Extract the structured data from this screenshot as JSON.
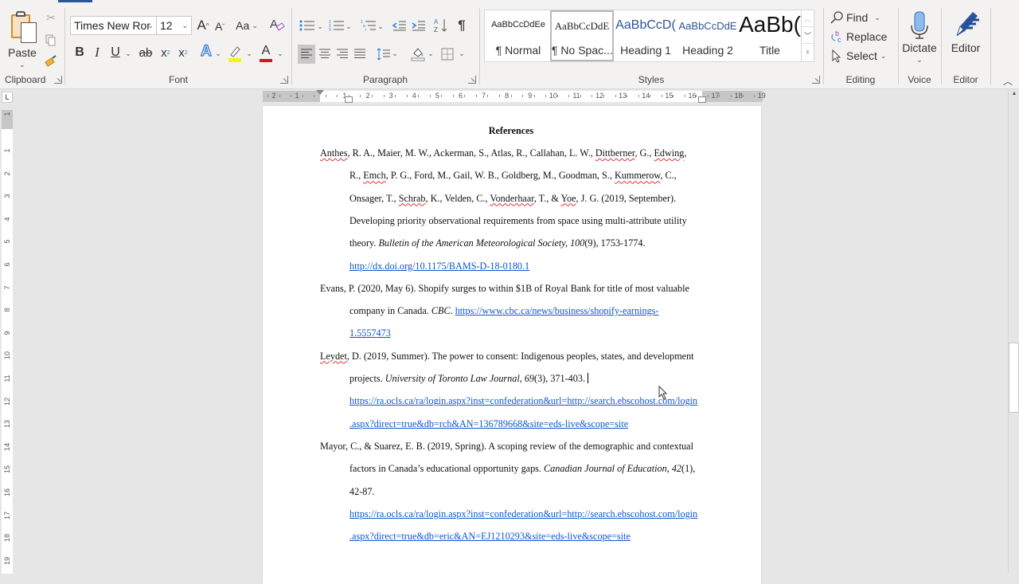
{
  "ribbon": {
    "clipboard": {
      "label": "Clipboard",
      "paste": "Paste"
    },
    "font": {
      "label": "Font",
      "font_name": "Times New Ror",
      "font_size": "12",
      "grow": "A",
      "shrink": "A",
      "change_case": "Aa",
      "bold": "B",
      "italic": "I",
      "underline": "U",
      "strikethrough": "ab",
      "subscript": "x",
      "superscript": "x",
      "text_effects": "A",
      "font_color": "A",
      "highlight_color": "#f5f11b",
      "font_color_value": "#d9161c"
    },
    "paragraph": {
      "label": "Paragraph",
      "show_marks": "¶"
    },
    "styles": {
      "label": "Styles",
      "items": [
        {
          "preview": "AaBbCcDdEe",
          "name": "¶ Normal"
        },
        {
          "preview": "AaBbCcDdE",
          "name": "¶ No Spac..."
        },
        {
          "preview": "AaBbCcD(",
          "name": "Heading 1"
        },
        {
          "preview": "AaBbCcDdE",
          "name": "Heading 2"
        },
        {
          "preview": "AaBb(",
          "name": "Title"
        }
      ]
    },
    "editing": {
      "label": "Editing",
      "find": "Find",
      "replace": "Replace",
      "select": "Select"
    },
    "voice": {
      "label": "Voice",
      "dictate": "Dictate"
    },
    "editor": {
      "label": "Editor",
      "editor_btn": "Editor"
    }
  },
  "rulers": {
    "horizontal": [
      "2",
      "1",
      "1",
      "2",
      "3",
      "4",
      "5",
      "6",
      "7",
      "8",
      "9",
      "10",
      "11",
      "12",
      "13",
      "14",
      "15",
      "16",
      "17",
      "18",
      "19"
    ],
    "vertical": [
      "1",
      "1",
      "2",
      "3",
      "4",
      "5",
      "6",
      "7",
      "8",
      "9",
      "10",
      "11",
      "12",
      "13",
      "14",
      "15",
      "16",
      "17",
      "18",
      "19"
    ]
  },
  "document": {
    "title": "References",
    "references": [
      {
        "lines": [
          [
            {
              "t": "Anthes",
              "sq": true
            },
            {
              "t": ", R. A., Maier, M. W., Ackerman, S., Atlas, R., Callahan, L. W., "
            },
            {
              "t": "Dittberner",
              "sq": true
            },
            {
              "t": ", G., "
            },
            {
              "t": "Edwing",
              "sq": true
            },
            {
              "t": ","
            }
          ],
          [
            {
              "t": "R., "
            },
            {
              "t": "Emch",
              "sq": true
            },
            {
              "t": ", P. G., Ford, M., Gail, W. B., Goldberg, M., Goodman, S., "
            },
            {
              "t": "Kummerow",
              "sq": true
            },
            {
              "t": ", C.,"
            }
          ],
          [
            {
              "t": "Onsager, T., "
            },
            {
              "t": "Schrab",
              "sq": true
            },
            {
              "t": ", K., Velden, C., "
            },
            {
              "t": "Vonderhaar",
              "sq": true
            },
            {
              "t": ", T., & "
            },
            {
              "t": "Yoe",
              "sq": true
            },
            {
              "t": ", J. G. (2019, September)."
            }
          ],
          [
            {
              "t": "Developing priority observational requirements from space using multi-attribute utility"
            }
          ],
          [
            {
              "t": "theory. "
            },
            {
              "t": "Bulletin of the American Meteorological Society, 100",
              "it": true
            },
            {
              "t": "(9), 1753-1774."
            }
          ],
          [
            {
              "t": "http://dx.doi.org/10.1175/BAMS-D-18-0180.1",
              "link": true
            }
          ]
        ]
      },
      {
        "lines": [
          [
            {
              "t": "Evans, P. (2020, May 6). Shopify surges to within $1B of Royal Bank for title of most valuable"
            }
          ],
          [
            {
              "t": "company in Canada. "
            },
            {
              "t": "CBC",
              "it": true
            },
            {
              "t": ". "
            },
            {
              "t": "https://www.cbc.ca/news/business/shopify-earnings-",
              "link": true
            }
          ],
          [
            {
              "t": "1.5557473",
              "link": true
            }
          ]
        ]
      },
      {
        "lines": [
          [
            {
              "t": "Leydet",
              "sq": true
            },
            {
              "t": ", D. (2019, Summer). The power to consent: Indigenous peoples, states, and development"
            }
          ],
          [
            {
              "t": "projects. "
            },
            {
              "t": "University of Toronto Law Journal, 69",
              "it": true
            },
            {
              "t": "(3), 371-403."
            },
            {
              "caret": true
            }
          ],
          [
            {
              "t": "https://ra.ocls.ca/ra/login.aspx?inst=confederation&url=http://search.ebscohost.com/login",
              "link": true
            }
          ],
          [
            {
              "t": ".aspx?direct=true&db=rch&AN=136789668&site=eds-live&scope=site",
              "link": true
            }
          ]
        ]
      },
      {
        "lines": [
          [
            {
              "t": "Mayor, C., & Suarez, E. B. (2019, Spring). A scoping review of the demographic and contextual"
            }
          ],
          [
            {
              "t": "factors in Canada’s educational opportunity gaps. "
            },
            {
              "t": "Canadian Journal of Education, 42",
              "it": true
            },
            {
              "t": "(1),"
            }
          ],
          [
            {
              "t": "42-87."
            }
          ],
          [
            {
              "t": "https://ra.ocls.ca/ra/login.aspx?inst=confederation&url=http://search.ebscohost.com/login",
              "link": true
            }
          ],
          [
            {
              "t": ".aspx?direct=true&db=eric&AN=EJ1210293&site=eds-live&scope=site",
              "link": true
            }
          ]
        ]
      }
    ]
  }
}
